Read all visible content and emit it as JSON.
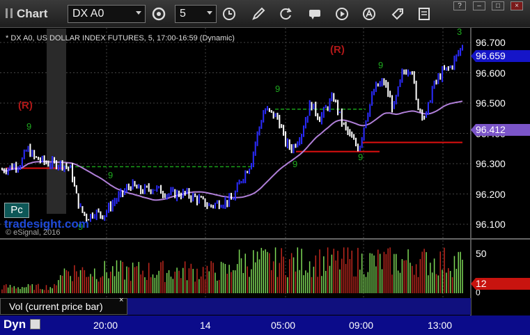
{
  "toolbar": {
    "app_title": "Chart",
    "symbol": "DX A0",
    "interval": "5",
    "win_help": "?",
    "win_min": "–",
    "win_restore": "□",
    "win_close": "×"
  },
  "chart": {
    "title": "* DX A0, US DOLLAR INDEX FUTURES, 5, 17:00-16:59 (Dynamic)",
    "pc_label": "Pc",
    "watermark": "tradesight.com",
    "copyright": "© eSignal, 2016",
    "r_label_1": "(R)",
    "r_label_2": "(R)",
    "last_price": "96.659",
    "ma_price": "96.412",
    "vol_value": "12"
  },
  "volume_pane": {
    "label": "Vol (current price bar)",
    "close": "×",
    "y_ticks": [
      "50",
      "0"
    ]
  },
  "bottom": {
    "dyn": "Dyn",
    "x_ticks": [
      "20:00",
      "14",
      "05:00",
      "09:00",
      "13:00"
    ]
  },
  "colors": {
    "up": "#2b2bff",
    "down": "#ffffff",
    "ma": "#b07fd8",
    "last_tag": "#1515c8",
    "ma_tag": "#7b55c8",
    "vol_up": "#7ed957",
    "vol_down": "#c0281e",
    "red_line": "#e01010",
    "green_line": "#1aa01a",
    "r_label": "#b01818"
  },
  "chart_data": {
    "type": "candlestick",
    "y_ticks": [
      "96.700",
      "96.600",
      "96.500",
      "96.400",
      "96.300",
      "96.200",
      "96.100"
    ],
    "ylim": [
      96.07,
      96.74
    ],
    "x_ticks": [
      "20:00",
      "14",
      "05:00",
      "09:00",
      "13:00"
    ],
    "last": 96.659,
    "moving_average_last": 96.412,
    "support_resistance": [
      {
        "price": 96.285,
        "color": "red"
      },
      {
        "price": 96.29,
        "color": "green-dashed"
      },
      {
        "price": 96.48,
        "color": "green-dashed"
      },
      {
        "price": 96.34,
        "color": "red"
      },
      {
        "price": 96.37,
        "color": "red"
      }
    ],
    "path": [
      [
        0,
        96.28
      ],
      [
        0.02,
        96.29
      ],
      [
        0.04,
        96.3
      ],
      [
        0.055,
        96.35
      ],
      [
        0.07,
        96.32
      ],
      [
        0.1,
        96.3
      ],
      [
        0.13,
        96.3
      ],
      [
        0.15,
        96.28
      ],
      [
        0.16,
        96.2
      ],
      [
        0.17,
        96.15
      ],
      [
        0.185,
        96.12
      ],
      [
        0.2,
        96.14
      ],
      [
        0.22,
        96.13
      ],
      [
        0.24,
        96.17
      ],
      [
        0.26,
        96.2
      ],
      [
        0.28,
        96.23
      ],
      [
        0.3,
        96.21
      ],
      [
        0.33,
        96.22
      ],
      [
        0.36,
        96.2
      ],
      [
        0.4,
        96.2
      ],
      [
        0.43,
        96.18
      ],
      [
        0.45,
        96.16
      ],
      [
        0.47,
        96.17
      ],
      [
        0.5,
        96.18
      ],
      [
        0.52,
        96.25
      ],
      [
        0.54,
        96.3
      ],
      [
        0.555,
        96.4
      ],
      [
        0.57,
        96.48
      ],
      [
        0.6,
        96.45
      ],
      [
        0.615,
        96.37
      ],
      [
        0.63,
        96.35
      ],
      [
        0.65,
        96.4
      ],
      [
        0.67,
        96.5
      ],
      [
        0.69,
        96.45
      ],
      [
        0.72,
        96.52
      ],
      [
        0.74,
        96.43
      ],
      [
        0.76,
        96.38
      ],
      [
        0.775,
        96.35
      ],
      [
        0.79,
        96.45
      ],
      [
        0.81,
        96.55
      ],
      [
        0.83,
        96.57
      ],
      [
        0.85,
        96.48
      ],
      [
        0.87,
        96.6
      ],
      [
        0.89,
        96.62
      ],
      [
        0.9,
        96.5
      ],
      [
        0.92,
        96.45
      ],
      [
        0.935,
        96.55
      ],
      [
        0.955,
        96.6
      ],
      [
        0.975,
        96.62
      ],
      [
        1.0,
        96.69
      ]
    ],
    "volume_ylim": [
      0,
      60
    ]
  }
}
